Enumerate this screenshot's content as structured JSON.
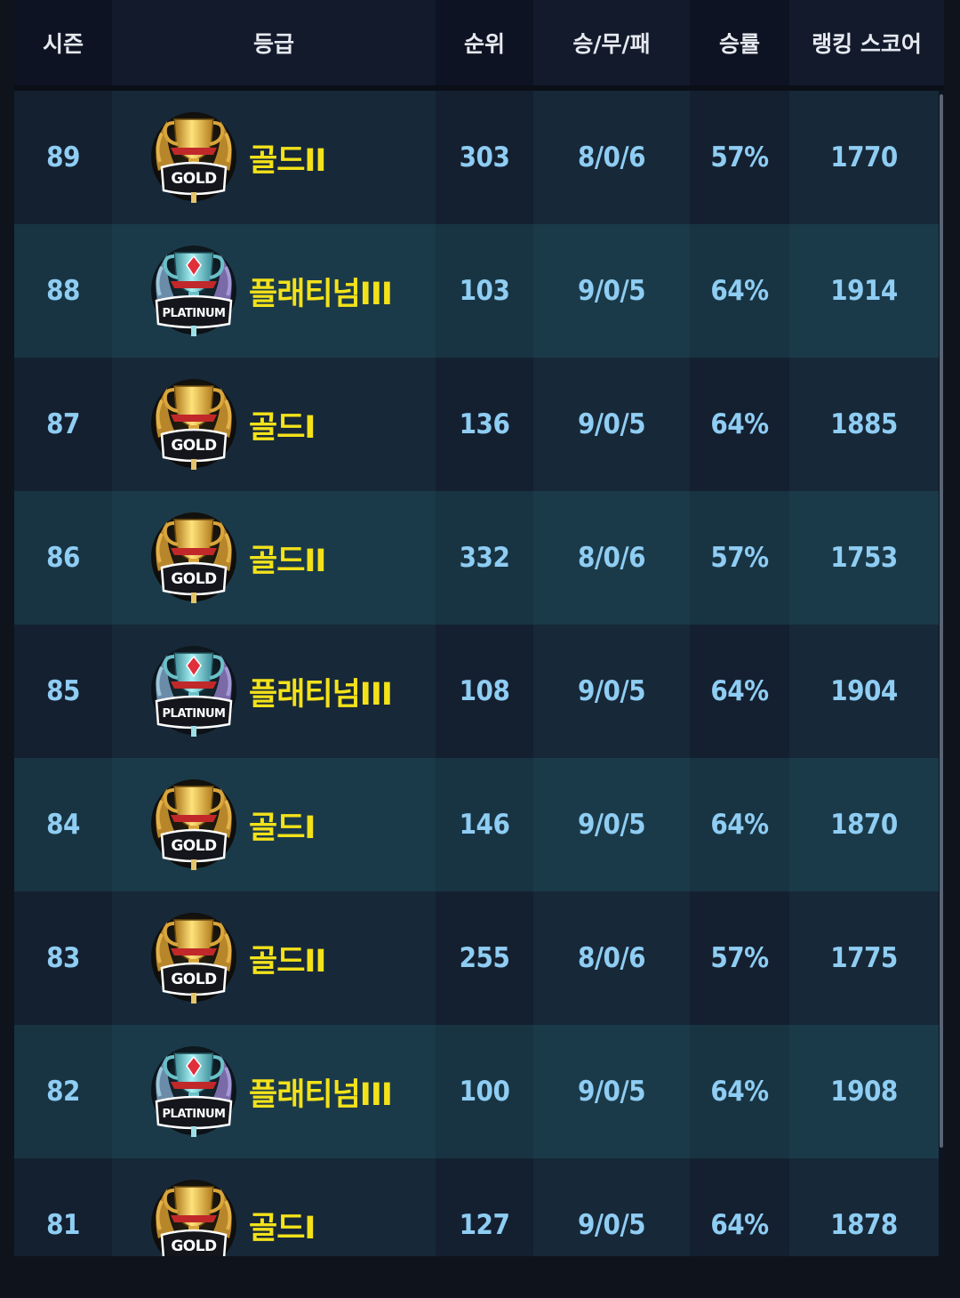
{
  "header": {
    "season": "시즌",
    "tier": "등급",
    "rank": "순위",
    "record": "승/무/패",
    "win_rate": "승률",
    "ranking_score": "랭킹 스코어"
  },
  "badge_text": {
    "gold": "GOLD",
    "platinum": "PLATINUM"
  },
  "colors": {
    "tier_text": "#f3e21a",
    "value_text": "#8fcdf3",
    "header_text": "#e6e9ef"
  },
  "rows": [
    {
      "season": "89",
      "badge": "gold-trophy-icon",
      "tier": "골드II",
      "rank": "303",
      "record": "8/0/6",
      "win_rate": "57%",
      "score": "1770"
    },
    {
      "season": "88",
      "badge": "platinum-trophy-icon",
      "tier": "플래티넘III",
      "rank": "103",
      "record": "9/0/5",
      "win_rate": "64%",
      "score": "1914"
    },
    {
      "season": "87",
      "badge": "gold-trophy-icon",
      "tier": "골드I",
      "rank": "136",
      "record": "9/0/5",
      "win_rate": "64%",
      "score": "1885"
    },
    {
      "season": "86",
      "badge": "gold-trophy-icon",
      "tier": "골드II",
      "rank": "332",
      "record": "8/0/6",
      "win_rate": "57%",
      "score": "1753"
    },
    {
      "season": "85",
      "badge": "platinum-trophy-icon",
      "tier": "플래티넘III",
      "rank": "108",
      "record": "9/0/5",
      "win_rate": "64%",
      "score": "1904"
    },
    {
      "season": "84",
      "badge": "gold-trophy-icon",
      "tier": "골드I",
      "rank": "146",
      "record": "9/0/5",
      "win_rate": "64%",
      "score": "1870"
    },
    {
      "season": "83",
      "badge": "gold-trophy-icon",
      "tier": "골드II",
      "rank": "255",
      "record": "8/0/6",
      "win_rate": "57%",
      "score": "1775"
    },
    {
      "season": "82",
      "badge": "platinum-trophy-icon",
      "tier": "플래티넘III",
      "rank": "100",
      "record": "9/0/5",
      "win_rate": "64%",
      "score": "1908"
    },
    {
      "season": "81",
      "badge": "gold-trophy-icon",
      "tier": "골드I",
      "rank": "127",
      "record": "9/0/5",
      "win_rate": "64%",
      "score": "1878"
    }
  ]
}
